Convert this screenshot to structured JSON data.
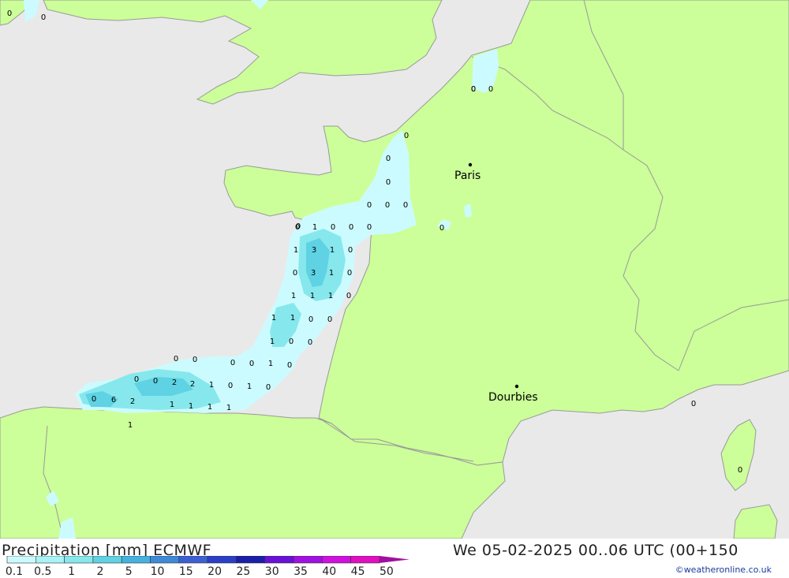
{
  "footer": {
    "title": "Precipitation [mm] ECMWF",
    "datetime": "We 05-02-2025 00..06 UTC (00+150",
    "credit": "©weatheronline.co.uk"
  },
  "legend": {
    "arrow_color": "#a010a0",
    "items": [
      {
        "label": "0.1",
        "color": "#ccfbff"
      },
      {
        "label": "0.5",
        "color": "#a8f3f5"
      },
      {
        "label": "1",
        "color": "#86e8ec"
      },
      {
        "label": "2",
        "color": "#5fd2e4"
      },
      {
        "label": "5",
        "color": "#45b2e0"
      },
      {
        "label": "10",
        "color": "#3e8ad8"
      },
      {
        "label": "15",
        "color": "#3a60d4"
      },
      {
        "label": "20",
        "color": "#2a3ec8"
      },
      {
        "label": "25",
        "color": "#1a1ea8"
      },
      {
        "label": "30",
        "color": "#6a10d8"
      },
      {
        "label": "35",
        "color": "#a010e0"
      },
      {
        "label": "40",
        "color": "#d010e0"
      },
      {
        "label": "45",
        "color": "#e010c0"
      },
      {
        "label": "50",
        "color": ""
      }
    ]
  },
  "colors": {
    "sea": "#e9e9e9",
    "land": "#ccff99",
    "border": "#999999"
  },
  "cities": [
    {
      "name": "Paris"
    },
    {
      "name": "Dourbies"
    }
  ],
  "grid_values": [
    "0",
    "0",
    "0",
    "0",
    "0",
    "0",
    "0",
    "0",
    "0",
    "0",
    "0",
    "1",
    "0",
    "0",
    "0",
    "0",
    "1",
    "3",
    "1",
    "0",
    "0",
    "3",
    "1",
    "0",
    "1",
    "1",
    "1",
    "0",
    "1",
    "1",
    "0",
    "0",
    "1",
    "0",
    "0",
    "0",
    "0",
    "0",
    "0",
    "1",
    "0",
    "0",
    "0",
    "2",
    "2",
    "1",
    "0",
    "1",
    "0",
    "0",
    "6",
    "2",
    "1",
    "1",
    "1",
    "1",
    "1",
    "0",
    "0",
    "0",
    "0"
  ]
}
